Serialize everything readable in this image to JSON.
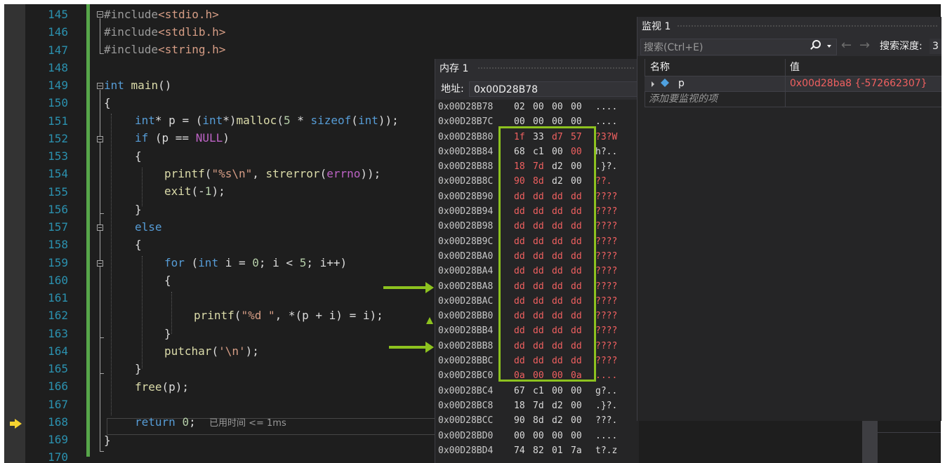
{
  "editor": {
    "line_numbers": [
      "145",
      "146",
      "147",
      "148",
      "149",
      "150",
      "151",
      "152",
      "153",
      "154",
      "155",
      "156",
      "157",
      "158",
      "159",
      "160",
      "161",
      "162",
      "163",
      "164",
      "165",
      "166",
      "167",
      "168",
      "169",
      "170"
    ],
    "elapsed_label": "已用时间 <= 1ms"
  },
  "memory_window": {
    "title": "内存 1",
    "address_label": "地址:",
    "address_value": "0x00D28B78",
    "rows": [
      {
        "addr": "0x00D28B78",
        "bytes": [
          "02",
          "00",
          "00",
          "00"
        ],
        "ascii": "....",
        "changed": [
          false,
          false,
          false,
          false
        ],
        "ascii_changed": false
      },
      {
        "addr": "0x00D28B7C",
        "bytes": [
          "00",
          "00",
          "00",
          "00"
        ],
        "ascii": "....",
        "changed": [
          false,
          false,
          false,
          false
        ],
        "ascii_changed": false
      },
      {
        "addr": "0x00D28B80",
        "bytes": [
          "1f",
          "33",
          "d7",
          "57"
        ],
        "ascii": "?3?W",
        "changed": [
          true,
          false,
          true,
          true
        ],
        "ascii_changed": true
      },
      {
        "addr": "0x00D28B84",
        "bytes": [
          "68",
          "c1",
          "00",
          "00"
        ],
        "ascii": "h?..",
        "changed": [
          false,
          false,
          false,
          true
        ],
        "ascii_changed": false
      },
      {
        "addr": "0x00D28B88",
        "bytes": [
          "18",
          "7d",
          "d2",
          "00"
        ],
        "ascii": ".}?.",
        "changed": [
          true,
          true,
          false,
          false
        ],
        "ascii_changed": false
      },
      {
        "addr": "0x00D28B8C",
        "bytes": [
          "90",
          "8d",
          "d2",
          "00"
        ],
        "ascii": "??.",
        "changed": [
          true,
          true,
          false,
          false
        ],
        "ascii_changed": true
      },
      {
        "addr": "0x00D28B90",
        "bytes": [
          "dd",
          "dd",
          "dd",
          "dd"
        ],
        "ascii": "????",
        "changed": [
          true,
          true,
          true,
          true
        ],
        "ascii_changed": true
      },
      {
        "addr": "0x00D28B94",
        "bytes": [
          "dd",
          "dd",
          "dd",
          "dd"
        ],
        "ascii": "????",
        "changed": [
          true,
          true,
          true,
          true
        ],
        "ascii_changed": true
      },
      {
        "addr": "0x00D28B98",
        "bytes": [
          "dd",
          "dd",
          "dd",
          "dd"
        ],
        "ascii": "????",
        "changed": [
          true,
          true,
          true,
          true
        ],
        "ascii_changed": true
      },
      {
        "addr": "0x00D28B9C",
        "bytes": [
          "dd",
          "dd",
          "dd",
          "dd"
        ],
        "ascii": "????",
        "changed": [
          true,
          true,
          true,
          true
        ],
        "ascii_changed": true
      },
      {
        "addr": "0x00D28BA0",
        "bytes": [
          "dd",
          "dd",
          "dd",
          "dd"
        ],
        "ascii": "????",
        "changed": [
          true,
          true,
          true,
          true
        ],
        "ascii_changed": true
      },
      {
        "addr": "0x00D28BA4",
        "bytes": [
          "dd",
          "dd",
          "dd",
          "dd"
        ],
        "ascii": "????",
        "changed": [
          true,
          true,
          true,
          true
        ],
        "ascii_changed": true
      },
      {
        "addr": "0x00D28BA8",
        "bytes": [
          "dd",
          "dd",
          "dd",
          "dd"
        ],
        "ascii": "????",
        "changed": [
          true,
          true,
          true,
          true
        ],
        "ascii_changed": true
      },
      {
        "addr": "0x00D28BAC",
        "bytes": [
          "dd",
          "dd",
          "dd",
          "dd"
        ],
        "ascii": "????",
        "changed": [
          true,
          true,
          true,
          true
        ],
        "ascii_changed": true
      },
      {
        "addr": "0x00D28BB0",
        "bytes": [
          "dd",
          "dd",
          "dd",
          "dd"
        ],
        "ascii": "????",
        "changed": [
          true,
          true,
          true,
          true
        ],
        "ascii_changed": true
      },
      {
        "addr": "0x00D28BB4",
        "bytes": [
          "dd",
          "dd",
          "dd",
          "dd"
        ],
        "ascii": "????",
        "changed": [
          true,
          true,
          true,
          true
        ],
        "ascii_changed": true
      },
      {
        "addr": "0x00D28BB8",
        "bytes": [
          "dd",
          "dd",
          "dd",
          "dd"
        ],
        "ascii": "????",
        "changed": [
          true,
          true,
          true,
          true
        ],
        "ascii_changed": true
      },
      {
        "addr": "0x00D28BBC",
        "bytes": [
          "dd",
          "dd",
          "dd",
          "dd"
        ],
        "ascii": "????",
        "changed": [
          true,
          true,
          true,
          true
        ],
        "ascii_changed": true
      },
      {
        "addr": "0x00D28BC0",
        "bytes": [
          "0a",
          "00",
          "00",
          "0a"
        ],
        "ascii": "....",
        "changed": [
          true,
          true,
          true,
          true
        ],
        "ascii_changed": true
      },
      {
        "addr": "0x00D28BC4",
        "bytes": [
          "67",
          "c1",
          "00",
          "00"
        ],
        "ascii": "g?..",
        "changed": [
          false,
          false,
          false,
          false
        ],
        "ascii_changed": false
      },
      {
        "addr": "0x00D28BC8",
        "bytes": [
          "18",
          "7d",
          "d2",
          "00"
        ],
        "ascii": ".}?.",
        "changed": [
          false,
          false,
          false,
          false
        ],
        "ascii_changed": false
      },
      {
        "addr": "0x00D28BCC",
        "bytes": [
          "90",
          "8d",
          "d2",
          "00"
        ],
        "ascii": "???.",
        "changed": [
          false,
          false,
          false,
          false
        ],
        "ascii_changed": false
      },
      {
        "addr": "0x00D28BD0",
        "bytes": [
          "00",
          "00",
          "00",
          "00"
        ],
        "ascii": "....",
        "changed": [
          false,
          false,
          false,
          false
        ],
        "ascii_changed": false
      },
      {
        "addr": "0x00D28BD4",
        "bytes": [
          "74",
          "82",
          "01",
          "7a"
        ],
        "ascii": "t?.z",
        "changed": [
          false,
          false,
          false,
          false
        ],
        "ascii_changed": false
      }
    ]
  },
  "watch_window": {
    "title": "监视 1",
    "search_placeholder": "搜索(Ctrl+E)",
    "depth_label": "搜索深度:",
    "depth_value": "3",
    "col_name": "名称",
    "col_value": "值",
    "items": [
      {
        "name": "p",
        "value": "0x00d28ba8 {-572662307}"
      }
    ],
    "add_item_placeholder": "添加要监视的项"
  },
  "colors": {
    "highlight": "#8dc21f",
    "changed_value": "#f06060",
    "keyword": "#569cd6",
    "string": "#d69d85"
  }
}
